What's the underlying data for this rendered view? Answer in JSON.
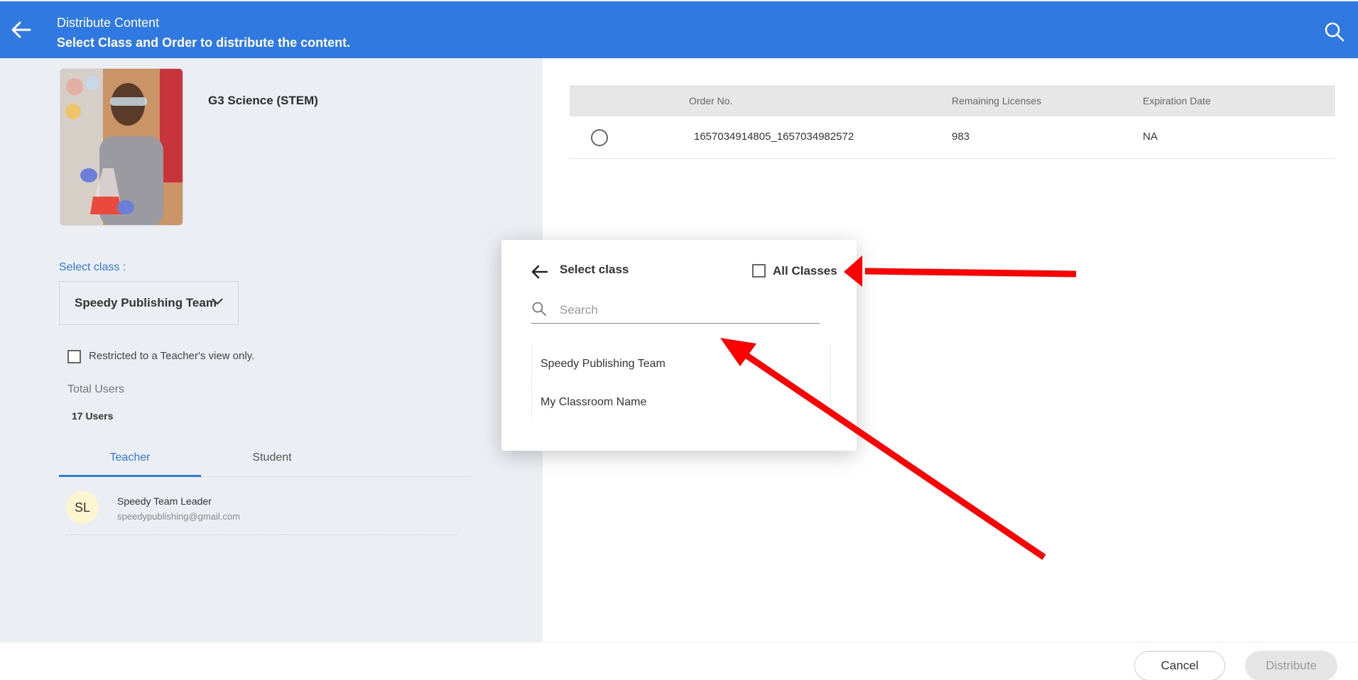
{
  "header": {
    "title": "Distribute Content",
    "subtitle": "Select Class and Order to distribute the content."
  },
  "product": {
    "title": "G3 Science (STEM)"
  },
  "class_select": {
    "label": "Select class :",
    "selected": "Speedy Publishing Team"
  },
  "restrict": {
    "label": "Restricted to a Teacher's view only."
  },
  "users": {
    "total_label": "Total Users",
    "count": "17 Users"
  },
  "tabs": [
    {
      "label": "Teacher"
    },
    {
      "label": "Student"
    }
  ],
  "user_list": [
    {
      "initials": "SL",
      "name": "Speedy Team Leader",
      "email": "speedypublishing@gmail.com"
    }
  ],
  "order_table": {
    "headers": [
      "Order No.",
      "Remaining Licenses",
      "Expiration Date"
    ],
    "rows": [
      {
        "order_no": "1657034914805_1657034982572",
        "remaining": "983",
        "expiration": "NA"
      }
    ]
  },
  "modal": {
    "title": "Select class",
    "all_classes": "All Classes",
    "search_placeholder": "Search",
    "classes": [
      "Speedy Publishing Team",
      "My Classroom Name"
    ]
  },
  "footer": {
    "cancel": "Cancel",
    "distribute": "Distribute"
  },
  "colors": {
    "header_bg": "#2f79e0",
    "accent": "#2f79e0",
    "annotation_arrow": "#ff0000"
  }
}
